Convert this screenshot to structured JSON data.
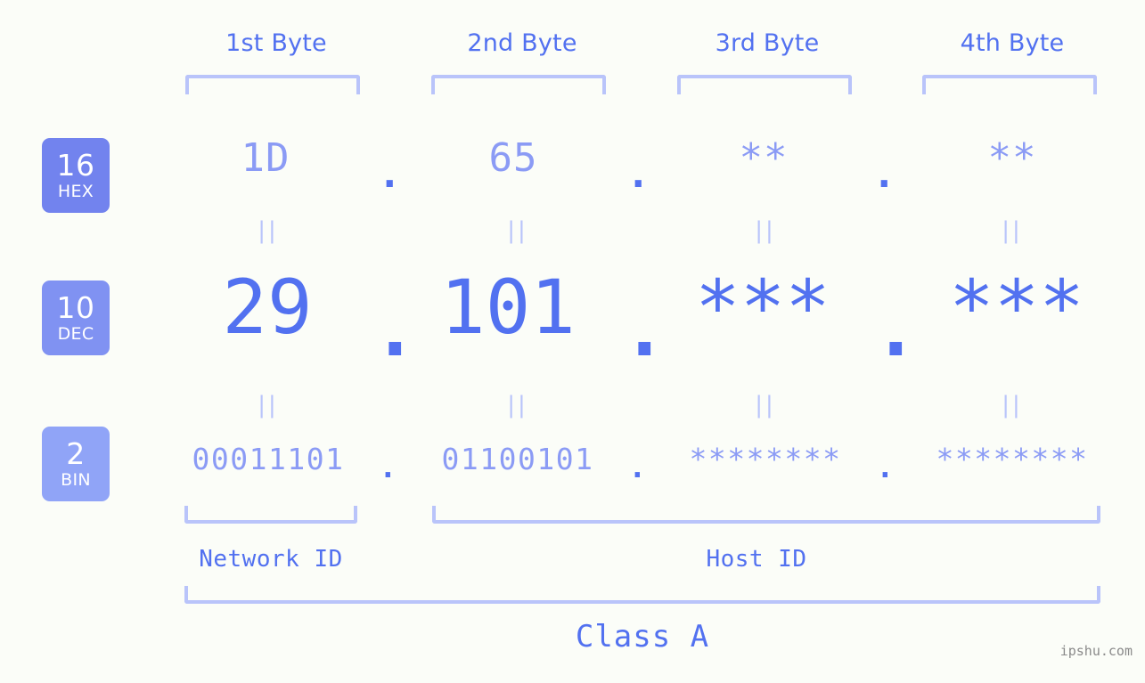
{
  "background_color": "#fbfdf8",
  "accent_color": "#5271f0",
  "accent_light_color": "#8b9bf5",
  "bracket_color": "#b9c4fa",
  "header": {
    "byte_labels": [
      {
        "label": "1st Byte"
      },
      {
        "label": "2nd Byte"
      },
      {
        "label": "3rd Byte"
      },
      {
        "label": "4th Byte"
      }
    ]
  },
  "rows": [
    {
      "radix_number": "16",
      "radix_name": "HEX",
      "badge_color": "#7283ee",
      "values": [
        "1D",
        "65",
        "**",
        "**"
      ],
      "separators": [
        ".",
        ".",
        "."
      ]
    },
    {
      "radix_number": "10",
      "radix_name": "DEC",
      "badge_color": "#8092f2",
      "values": [
        "29",
        "101",
        "***",
        "***"
      ],
      "separators": [
        ".",
        ".",
        "."
      ]
    },
    {
      "radix_number": "2",
      "radix_name": "BIN",
      "badge_color": "#90a4f7",
      "values": [
        "00011101",
        "01100101",
        "********",
        "********"
      ],
      "separators": [
        ".",
        ".",
        "."
      ]
    }
  ],
  "equality_marks": {
    "row1": [
      "||",
      "||",
      "||",
      "||"
    ],
    "row2": [
      "||",
      "||",
      "||",
      "||"
    ]
  },
  "footer": {
    "network_id_label": "Network ID",
    "host_id_label": "Host ID",
    "class_label": "Class A"
  },
  "watermark": "ipshu.com"
}
